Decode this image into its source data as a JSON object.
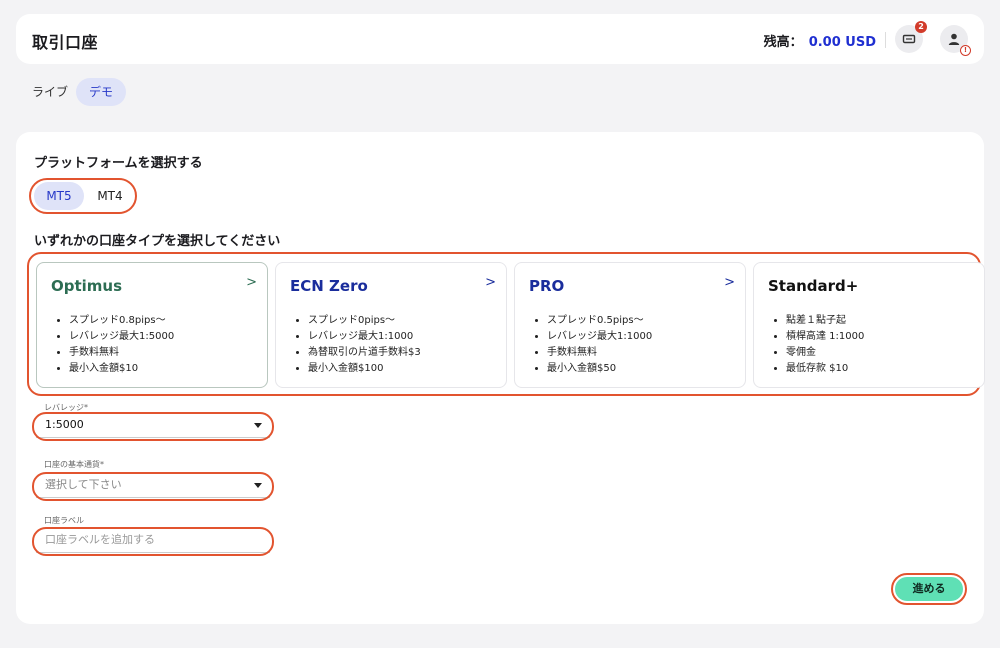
{
  "header": {
    "title": "取引口座",
    "balance_label": "残高：",
    "balance_value": "0.00 USD",
    "ticket_badge": "2"
  },
  "tabs": [
    {
      "label": "ライブ",
      "active": false
    },
    {
      "label": "デモ",
      "active": true
    }
  ],
  "platform": {
    "heading": "プラットフォームを選択する",
    "options": [
      {
        "label": "MT5",
        "selected": true
      },
      {
        "label": "MT4",
        "selected": false
      }
    ]
  },
  "account_types": {
    "heading": "いずれかの口座タイプを選択してください",
    "cards": [
      {
        "name": "Optimus",
        "has_chevron": true,
        "selected": true,
        "features": [
          "スプレッド0.8pips〜",
          "レバレッジ最大1:5000",
          "手数料無料",
          "最小入金額$10"
        ]
      },
      {
        "name": "ECN Zero",
        "has_chevron": true,
        "selected": false,
        "features": [
          "スプレッド0pips〜",
          "レバレッジ最大1:1000",
          "為替取引の片道手数料$3",
          "最小入金額$100"
        ]
      },
      {
        "name": "PRO",
        "has_chevron": true,
        "selected": false,
        "features": [
          "スプレッド0.5pips〜",
          "レバレッジ最大1:1000",
          "手数料無料",
          "最小入金額$50"
        ]
      },
      {
        "name": "Standard+",
        "has_chevron": false,
        "selected": false,
        "features": [
          "點差１點子起",
          "槓桿高達 1:1000",
          "零佣金",
          "最低存款 $10"
        ]
      }
    ]
  },
  "form": {
    "leverage_label": "レバレッジ*",
    "leverage_value": "1:5000",
    "currency_label": "口座の基本通貨*",
    "currency_placeholder": "選択して下さい",
    "account_label_label": "口座ラベル",
    "account_label_placeholder": "口座ラベルを追加する"
  },
  "next_button": "進める",
  "colors": {
    "accent_blue": "#1f2fd1",
    "highlight_ring": "#e2542f",
    "next_button": "#5fe0b5",
    "optimus_green": "#2d6d53"
  }
}
